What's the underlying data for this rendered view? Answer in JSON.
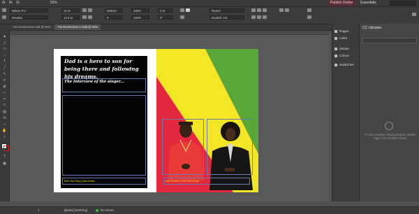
{
  "menubar": {
    "menus": [
      "Ai",
      "Br",
      "St"
    ],
    "zoom": "50%",
    "publish_label": "Publish Online",
    "workspace": "Essentials"
  },
  "control": {
    "font": "Writon Pro",
    "style": "Regular",
    "size": "12 pt",
    "leading": "14.4 pt",
    "metrics": "Metrics",
    "tracking": "0",
    "scale_v": "100%",
    "scale_h": "100%",
    "baseline": "0 pt",
    "skew": "0°",
    "para_style": "[None]",
    "language": "English: UK"
  },
  "tabs": [
    {
      "label": "*Ab Rochemom.indd @ 50%"
    },
    {
      "label": "*Ab Rochemom 2.indd @ 50%"
    }
  ],
  "document": {
    "headline": "Dad is a hero to son for being there and following his dreams.",
    "subhead": "The Interview of the singer...",
    "footer_left": "Bob's Day Reply | Nate Hodem",
    "footer_right": "Nate Romano | Street Day Boogie"
  },
  "panels": {
    "items": [
      "Pages",
      "Links",
      "Stroke",
      "Colour",
      "Swatches"
    ],
    "cc_title": "CC Libraries",
    "cc_message": "To use Creative Cloud Libraries, please sign in to Creative Cloud."
  },
  "status": {
    "page": "1",
    "style": "[Basic] (working)",
    "errors": "No errors"
  },
  "colors": {
    "ui_dark": "#3a3a3a",
    "pasteboard": "#595959",
    "flag_red": "#e6283e",
    "flag_yellow": "#f2e627",
    "flag_green": "#5aa83a",
    "frame_blue": "#6c79ad",
    "footer_text": "#e4e400"
  }
}
